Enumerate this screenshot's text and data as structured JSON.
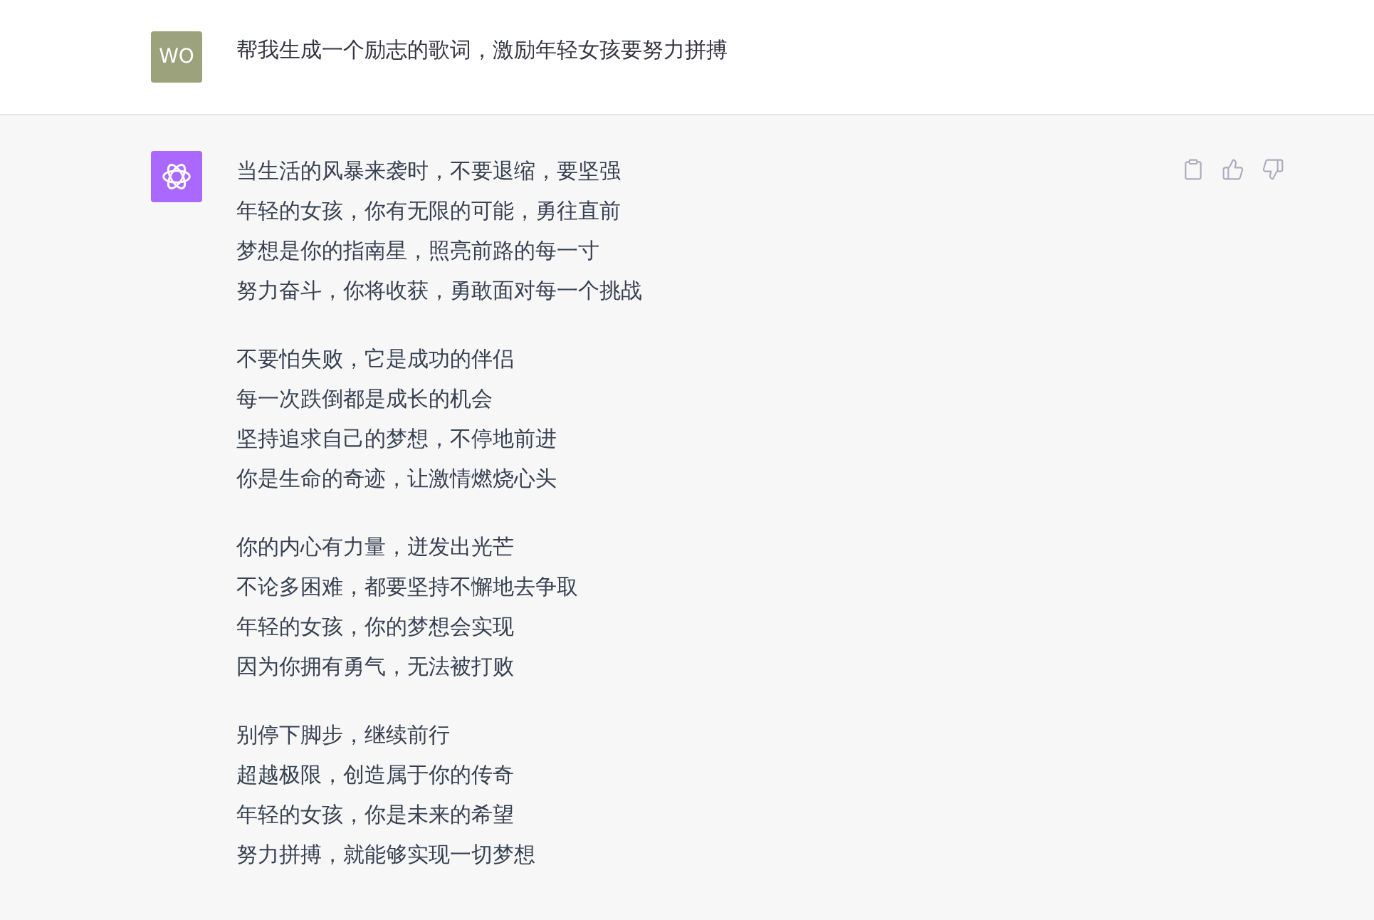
{
  "user_message": {
    "avatar": "WO",
    "text": "帮我生成一个励志的歌词，激励年轻女孩要努力拼搏"
  },
  "assistant_message": {
    "stanzas": [
      [
        "当生活的风暴来袭时，不要退缩，要坚强",
        "年轻的女孩，你有无限的可能，勇往直前",
        "梦想是你的指南星，照亮前路的每一寸",
        "努力奋斗，你将收获，勇敢面对每一个挑战"
      ],
      [
        "不要怕失败，它是成功的伴侣",
        "每一次跌倒都是成长的机会",
        "坚持追求自己的梦想，不停地前进",
        "你是生命的奇迹，让激情燃烧心头"
      ],
      [
        "你的内心有力量，迸发出光芒",
        "不论多困难，都要坚持不懈地去争取",
        "年轻的女孩，你的梦想会实现",
        "因为你拥有勇气，无法被打败"
      ],
      [
        "别停下脚步，继续前行",
        "超越极限，创造属于你的传奇",
        "年轻的女孩，你是未来的希望",
        "努力拼搏，就能够实现一切梦想"
      ]
    ]
  }
}
